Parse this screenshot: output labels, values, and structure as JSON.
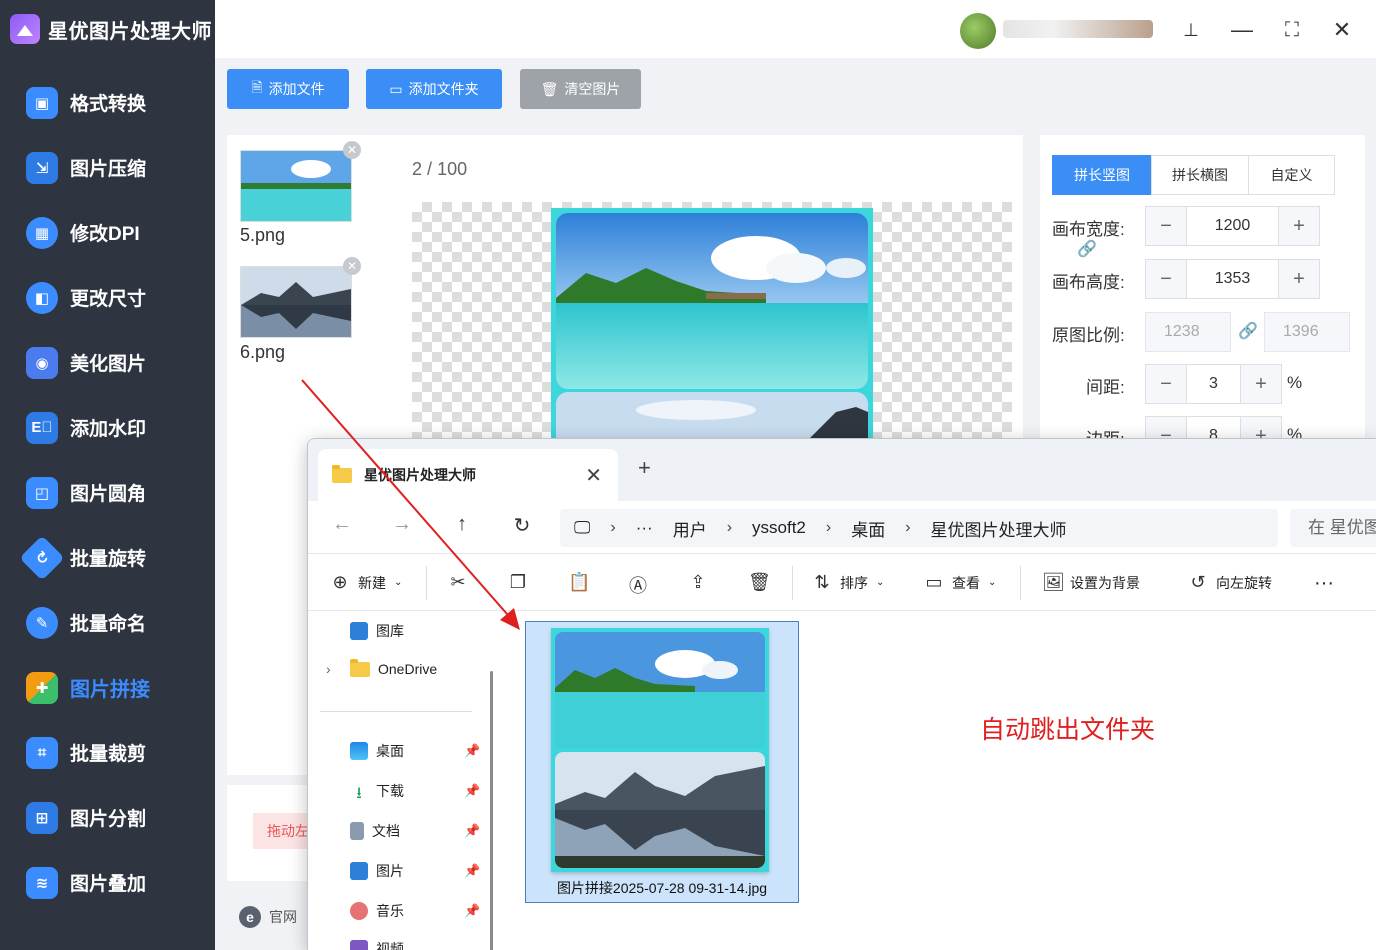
{
  "app": {
    "title": "星优图片处理大师"
  },
  "sidebar": {
    "items": [
      {
        "label": "格式转换",
        "color": "#3b8cff",
        "active": false
      },
      {
        "label": "图片压缩",
        "color": "#2f7be6",
        "active": false
      },
      {
        "label": "修改DPI",
        "color": "#3b8cff",
        "active": false
      },
      {
        "label": "更改尺寸",
        "color": "#3b8cff",
        "active": false
      },
      {
        "label": "美化图片",
        "color": "#4a7cf0",
        "active": false
      },
      {
        "label": "添加水印",
        "color": "#2f7be6",
        "active": false
      },
      {
        "label": "图片圆角",
        "color": "#3b8cff",
        "active": false
      },
      {
        "label": "批量旋转",
        "color": "#3b8cff",
        "active": false
      },
      {
        "label": "批量命名",
        "color": "#3b8cff",
        "active": false
      },
      {
        "label": "图片拼接",
        "color": "#f39c12",
        "active": true
      },
      {
        "label": "批量裁剪",
        "color": "#3b8cff",
        "active": false
      },
      {
        "label": "图片分割",
        "color": "#2f7be6",
        "active": false
      },
      {
        "label": "图片叠加",
        "color": "#3b8cff",
        "active": false
      }
    ]
  },
  "toolbar": {
    "add_file": "添加文件",
    "add_folder": "添加文件夹",
    "clear": "清空图片"
  },
  "files": [
    {
      "name": "5.png"
    },
    {
      "name": "6.png"
    }
  ],
  "counter": {
    "current": "2",
    "sep": "/",
    "total": "100"
  },
  "drag_hint": "拖动左",
  "footer": {
    "official_site": "官网"
  },
  "settings": {
    "tabs": [
      "拼长竖图",
      "拼长横图",
      "自定义"
    ],
    "canvas_width_label": "画布宽度:",
    "canvas_width": "1200",
    "canvas_height_label": "画布高度:",
    "canvas_height": "1353",
    "ratio_label": "原图比例:",
    "ratio_w": "1238",
    "ratio_h": "1396",
    "spacing_label": "间距:",
    "spacing": "3",
    "margin_label": "边距:",
    "margin": "8",
    "unit": "%"
  },
  "explorer": {
    "tab_title": "星优图片处理大师",
    "breadcrumbs": [
      "用户",
      "yssoft2",
      "桌面",
      "星优图片处理大师"
    ],
    "search_placeholder": "在 星优图",
    "commands": {
      "new": "新建",
      "sort": "排序",
      "view": "查看",
      "set_bg": "设置为背景",
      "rotate_left": "向左旋转"
    },
    "tree": [
      {
        "label": "图库"
      },
      {
        "label": "OneDrive"
      },
      {
        "label": "桌面"
      },
      {
        "label": "下载"
      },
      {
        "label": "文档"
      },
      {
        "label": "图片"
      },
      {
        "label": "音乐"
      },
      {
        "label": "视频"
      }
    ],
    "file_name": "图片拼接2025-07-28 09-31-14.jpg"
  },
  "annotation": "自动跳出文件夹"
}
